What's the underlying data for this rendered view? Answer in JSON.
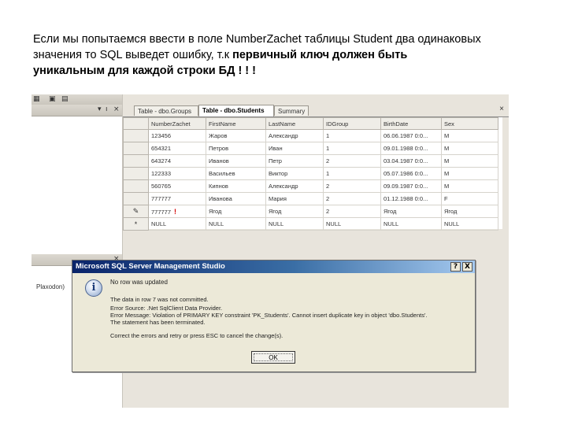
{
  "caption": {
    "line1": "Если мы попытаемся ввести в поле NumberZachet таблицы Student два одинаковых",
    "line2_plain": "значения то SQL выведет ошибку, т.к ",
    "line2_bold": "первичный ключ должен быть",
    "line3_bold": "уникальным для каждой строки БД ! ! !"
  },
  "left_pane": {
    "bottom_label": "Plaxodon)"
  },
  "tabs": [
    {
      "label": "Table - dbo.Groups"
    },
    {
      "label": "Table - dbo.Students"
    },
    {
      "label": "Summary"
    }
  ],
  "grid": {
    "columns": [
      "NumberZachet",
      "FirstName",
      "LastName",
      "IDGroup",
      "BirthDate",
      "Sex"
    ],
    "rows": [
      {
        "selector": "",
        "cells": [
          "123456",
          "Жаров",
          "Александр",
          "1",
          "06.06.1987 0:0...",
          "M"
        ]
      },
      {
        "selector": "",
        "cells": [
          "654321",
          "Петров",
          "Иван",
          "1",
          "09.01.1988 0:0...",
          "M"
        ]
      },
      {
        "selector": "",
        "cells": [
          "643274",
          "Иванов",
          "Петр",
          "2",
          "03.04.1987 0:0...",
          "M"
        ]
      },
      {
        "selector": "",
        "cells": [
          "122333",
          "Васильев",
          "Виктор",
          "1",
          "05.07.1986 0:0...",
          "M"
        ]
      },
      {
        "selector": "",
        "cells": [
          "560765",
          "Кипнов",
          "Александр",
          "2",
          "09.09.1987 0:0...",
          "M"
        ]
      },
      {
        "selector": "",
        "cells": [
          "777777",
          "Иванова",
          "Мария",
          "2",
          "01.12.1988 0:0...",
          "F"
        ]
      },
      {
        "selector": "✎",
        "cells": [
          "777777",
          "Ягод",
          "Ягод",
          "2",
          "Ягод",
          "Ягод"
        ],
        "error_mark": "!"
      },
      {
        "selector": "*",
        "cells": [
          "NULL",
          "NULL",
          "NULL",
          "NULL",
          "NULL",
          "NULL"
        ]
      }
    ]
  },
  "dialog": {
    "title": "Microsoft SQL Server Management Studio",
    "help_button": "?",
    "close_button": "X",
    "icon_glyph": "i",
    "line1": "No row was updated",
    "line2": "The data in row 7 was not committed.",
    "line3": "Error Source: .Net SqlClient Data Provider.",
    "line4": "Error Message: Violation of PRIMARY KEY constraint 'PK_Students'. Cannot insert duplicate key in object 'dbo.Students'.",
    "line5": "The statement has been terminated.",
    "line6": "Correct the errors and retry or press ESC to cancel the change(s).",
    "ok_label": "OK"
  }
}
